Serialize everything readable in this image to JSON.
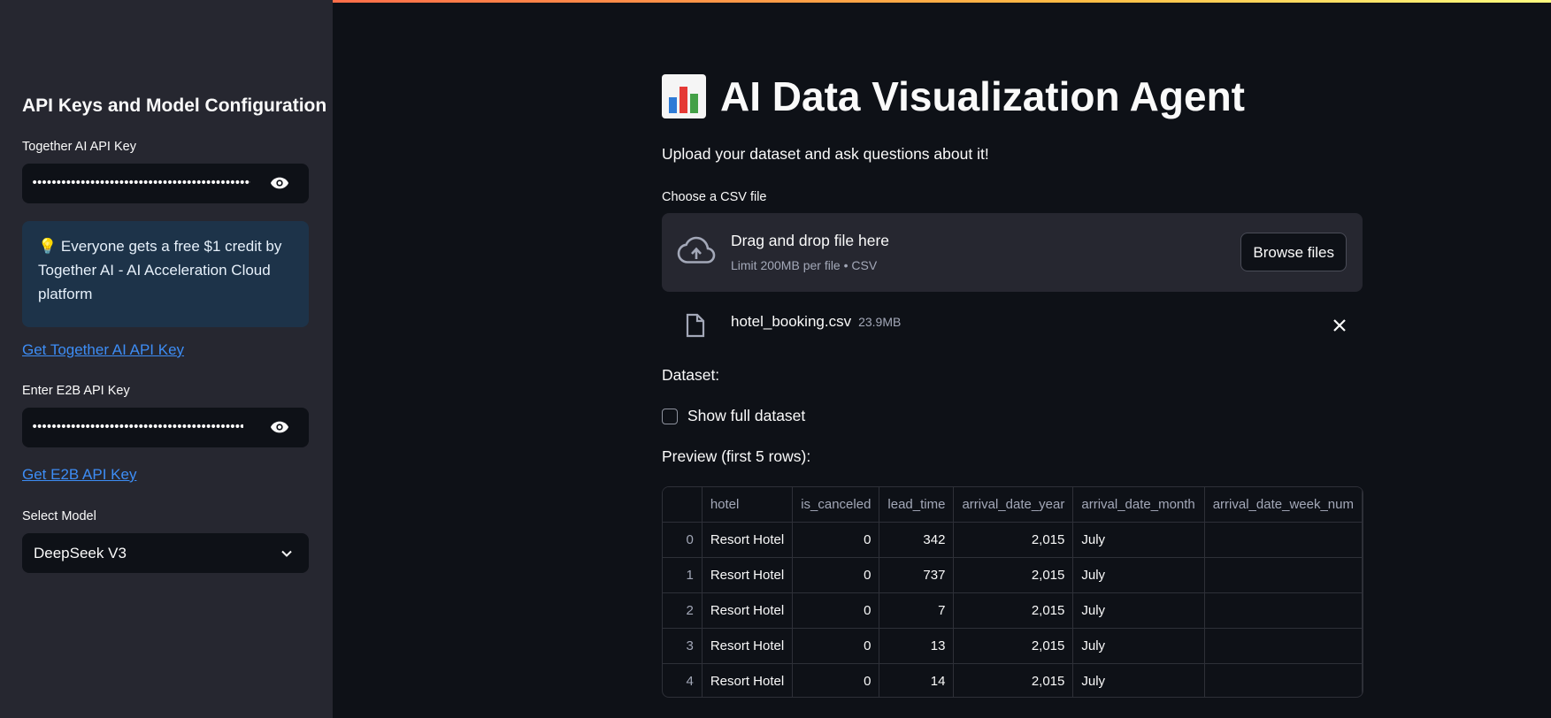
{
  "sidebar": {
    "title": "API Keys and Model Configuration",
    "together_label": "Together AI API Key",
    "together_value": "•••••••••••••••••••••••••••••••••••••••••••••••••••••••••••••••••",
    "info_icon": "💡",
    "info_text": "Everyone gets a free $1 credit by Together AI - AI Acceleration Cloud platform",
    "together_link": "Get Together AI API Key",
    "e2b_label": "Enter E2B API Key",
    "e2b_value": "•••••••••••••••••••••••••••••••••••••••••••••••••••••••••••••••",
    "e2b_link": "Get E2B API Key",
    "model_label": "Select Model",
    "model_value": "DeepSeek V3",
    "icons": {
      "visibility": "eye-icon",
      "dropdown": "chevron-down-icon",
      "info": "lightbulb-icon"
    }
  },
  "main": {
    "title_icon": "bar-chart-icon",
    "title": "AI Data Visualization Agent",
    "subtitle": "Upload your dataset and ask questions about it!",
    "uploader_label": "Choose a CSV file",
    "drag_title": "Drag and drop file here",
    "drag_sub": "Limit 200MB per file • CSV",
    "browse_label": "Browse files",
    "file_name": "hotel_booking.csv",
    "file_size": "23.9MB",
    "dataset_label": "Dataset:",
    "show_full_label": "Show full dataset",
    "preview_label": "Preview (first 5 rows):"
  },
  "table": {
    "columns": [
      "",
      "hotel",
      "is_canceled",
      "lead_time",
      "arrival_date_year",
      "arrival_date_month",
      "arrival_date_week_num"
    ],
    "rows": [
      [
        "0",
        "Resort Hotel",
        "0",
        "342",
        "2,015",
        "July",
        ""
      ],
      [
        "1",
        "Resort Hotel",
        "0",
        "737",
        "2,015",
        "July",
        ""
      ],
      [
        "2",
        "Resort Hotel",
        "0",
        "7",
        "2,015",
        "July",
        ""
      ],
      [
        "3",
        "Resort Hotel",
        "0",
        "13",
        "2,015",
        "July",
        ""
      ],
      [
        "4",
        "Resort Hotel",
        "0",
        "14",
        "2,015",
        "July",
        ""
      ]
    ]
  },
  "colors": {
    "background": "#0e1117",
    "sidebar": "#262730",
    "link": "#3d8df5",
    "info_bg": "#1d3349"
  }
}
